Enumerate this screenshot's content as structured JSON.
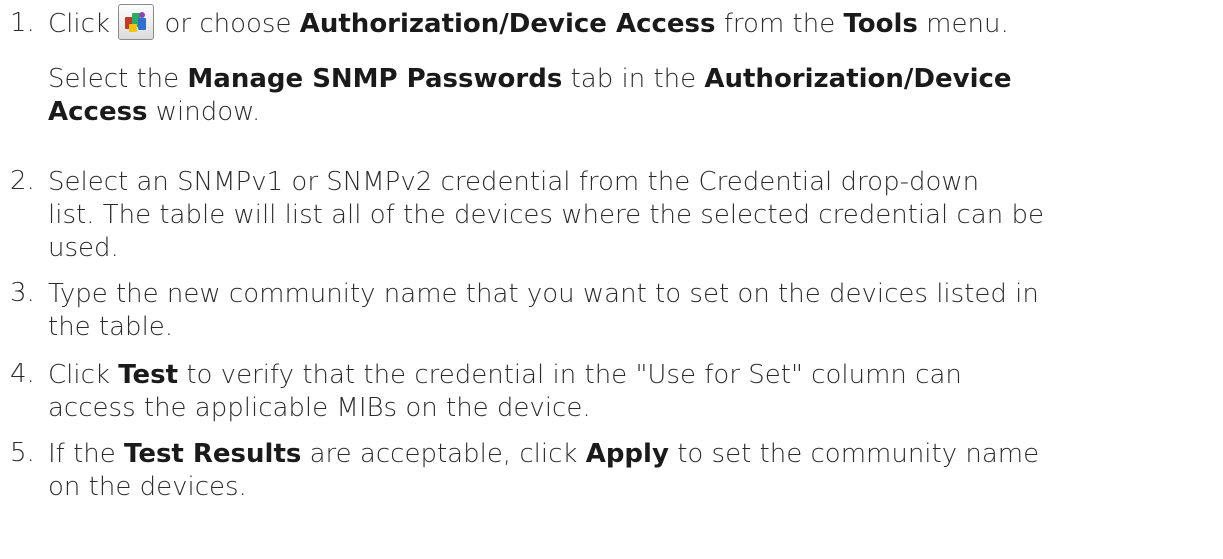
{
  "steps": [
    {
      "number": "1.",
      "text": {
        "a": "Click",
        "b": "or choose",
        "c": "Authorization/Device Access",
        "d": "from the",
        "e": "Tools",
        "f": "menu."
      },
      "icon": "authorization-device-access-tool-icon",
      "sub": {
        "a": "Select the",
        "b": "Manage SNMP Passwords",
        "c": "tab in the",
        "d": "Authorization/Device",
        "e": "Access",
        "f": "window."
      }
    },
    {
      "number": "2.",
      "lines": [
        "Select an SNMPv1 or SNMPv2 credential from the Credential drop-down",
        "list. The table will list all of the devices where the selected credential can be",
        "used."
      ]
    },
    {
      "number": "3.",
      "lines": [
        "Type the new community name that you want to set on the devices listed in",
        "the table."
      ]
    },
    {
      "number": "4.",
      "text": {
        "a": "Click",
        "b": "Test",
        "c": "to verify that the credential in the \"Use for Set\" column can"
      },
      "line2": "access the applicable MIBs on the device."
    },
    {
      "number": "5.",
      "text": {
        "a": "If the",
        "b": "Test Results",
        "c": "are acceptable, click",
        "d": "Apply",
        "e": "to set the community name"
      },
      "line2": "on the devices."
    }
  ]
}
